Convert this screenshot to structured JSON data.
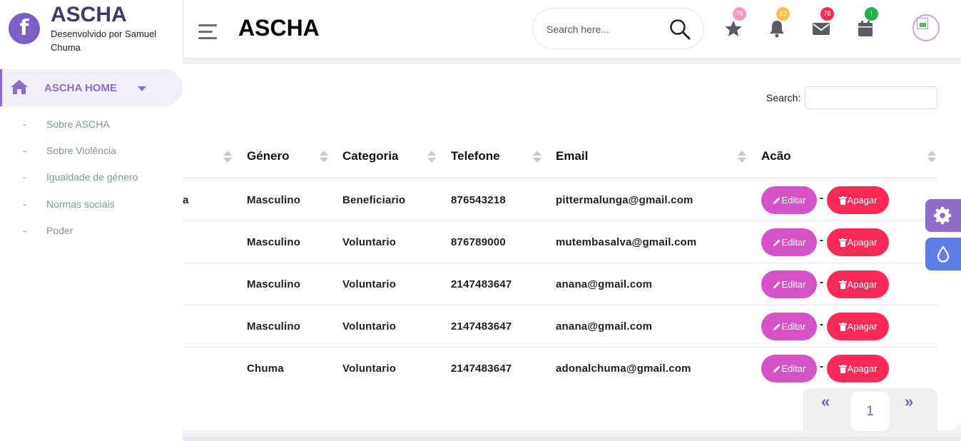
{
  "brand": {
    "logo_letter": "f",
    "title": "ASCHA",
    "subtitle": "Desenvolvido por Samuel Chuma"
  },
  "sidebar": {
    "home_label": "ASCHA HOME",
    "items": [
      {
        "label": "Sobre ASCHA"
      },
      {
        "label": "Sobre Violência"
      },
      {
        "label": "Igualdade de género"
      },
      {
        "label": "Normas sociais"
      },
      {
        "label": "Poder"
      }
    ],
    "dash": "-",
    "accent": "#8e6cc9"
  },
  "header": {
    "page_title": "ASCHA",
    "search_placeholder": "Search here...",
    "badges": {
      "favorites": "76",
      "notifications": "12",
      "messages": "78",
      "calendar": "!"
    },
    "badge_colors": {
      "favorites": "#f49ac1",
      "notifications": "#f5c04f",
      "messages": "#ff2a55",
      "calendar": "#22b24c"
    }
  },
  "table": {
    "search_label": "Search:",
    "search_value": "",
    "columns": [
      "Género",
      "Categoria",
      "Telefone",
      "Email",
      "Acão"
    ],
    "first_row_partial": "a",
    "rows": [
      {
        "genero": "Masculino",
        "categoria": "Beneficiario",
        "telefone": "876543218",
        "email": "pittermalunga@gmail.com"
      },
      {
        "genero": "Masculino",
        "categoria": "Voluntario",
        "telefone": "876789000",
        "email": "mutembasalva@gmail.com"
      },
      {
        "genero": "Masculino",
        "categoria": "Voluntario",
        "telefone": "2147483647",
        "email": "anana@gmail.com"
      },
      {
        "genero": "Masculino",
        "categoria": "Voluntario",
        "telefone": "2147483647",
        "email": "anana@gmail.com"
      },
      {
        "genero": "Chuma",
        "categoria": "Voluntario",
        "telefone": "2147483647",
        "email": "adonalchuma@gmail.com"
      }
    ],
    "edit_label": "Editar",
    "delete_label": "Apagar",
    "separator": "-",
    "edit_color": "#d652c8",
    "delete_color": "#ff2a55"
  },
  "pagination": {
    "prev": "«",
    "next": "»",
    "current": "1"
  },
  "icons": {
    "menu": "hamburger-icon",
    "search": "search-icon",
    "favorites": "star-icon",
    "notifications": "bell-icon",
    "messages": "envelope-icon",
    "calendar": "calendar-icon",
    "home": "home-icon",
    "settings": "gear-icon",
    "theme": "droplet-icon"
  }
}
